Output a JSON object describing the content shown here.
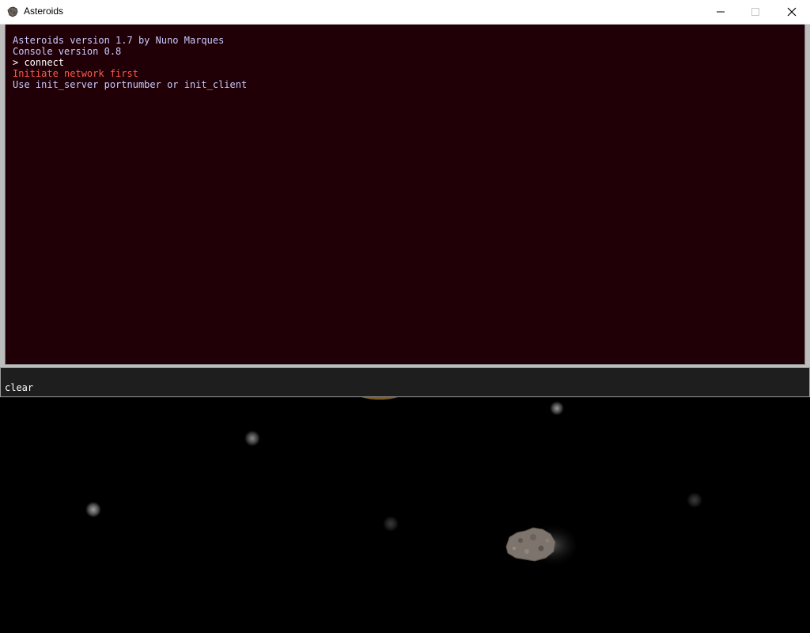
{
  "window": {
    "title": "Asteroids",
    "icon": "asteroid-app-icon",
    "controls": [
      "minimize-icon",
      "maximize-icon",
      "close-icon"
    ]
  },
  "console": {
    "lines": [
      {
        "text": "Asteroids version 1.7 by Nuno Marques",
        "kind": "normal"
      },
      {
        "text": "Console version 0.8",
        "kind": "normal"
      },
      {
        "text": "> connect",
        "kind": "echo"
      },
      {
        "text": "Initiate network first",
        "kind": "error"
      },
      {
        "text": "Use init_server portnumber or init_client",
        "kind": "normal"
      }
    ],
    "input_value": "clear",
    "colors": {
      "background": "#200006",
      "text": "#c8ccff",
      "error": "#ff5a4a",
      "input_background": "#1e1e1e"
    }
  },
  "game": {
    "background": "#000000"
  }
}
